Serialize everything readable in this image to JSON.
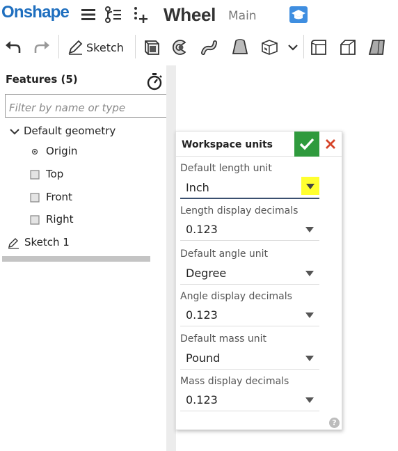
{
  "app": {
    "logo": "Onshape",
    "document_title": "Wheel",
    "branch": "Main"
  },
  "toolbar": {
    "sketch_label": "Sketch"
  },
  "features": {
    "header": "Features (5)",
    "filter_placeholder": "Filter by name or type",
    "default_geometry": "Default geometry",
    "items": [
      {
        "label": "Origin",
        "icon": "origin-icon"
      },
      {
        "label": "Top",
        "icon": "plane-icon"
      },
      {
        "label": "Front",
        "icon": "plane-icon"
      },
      {
        "label": "Right",
        "icon": "plane-icon"
      }
    ],
    "sketch": {
      "label": "Sketch 1",
      "icon": "pencil-icon"
    }
  },
  "dialog": {
    "title": "Workspace units",
    "fields": [
      {
        "label": "Default length unit",
        "value": "Inch"
      },
      {
        "label": "Length display decimals",
        "value": "0.123"
      },
      {
        "label": "Default angle unit",
        "value": "Degree"
      },
      {
        "label": "Angle display decimals",
        "value": "0.123"
      },
      {
        "label": "Default mass unit",
        "value": "Pound"
      },
      {
        "label": "Mass display decimals",
        "value": "0.123"
      }
    ],
    "help": "?"
  },
  "colors": {
    "brand": "#1f6fbf",
    "ok": "#2f9a3d",
    "cancel": "#d6452a",
    "highlight": "#ffff30"
  }
}
